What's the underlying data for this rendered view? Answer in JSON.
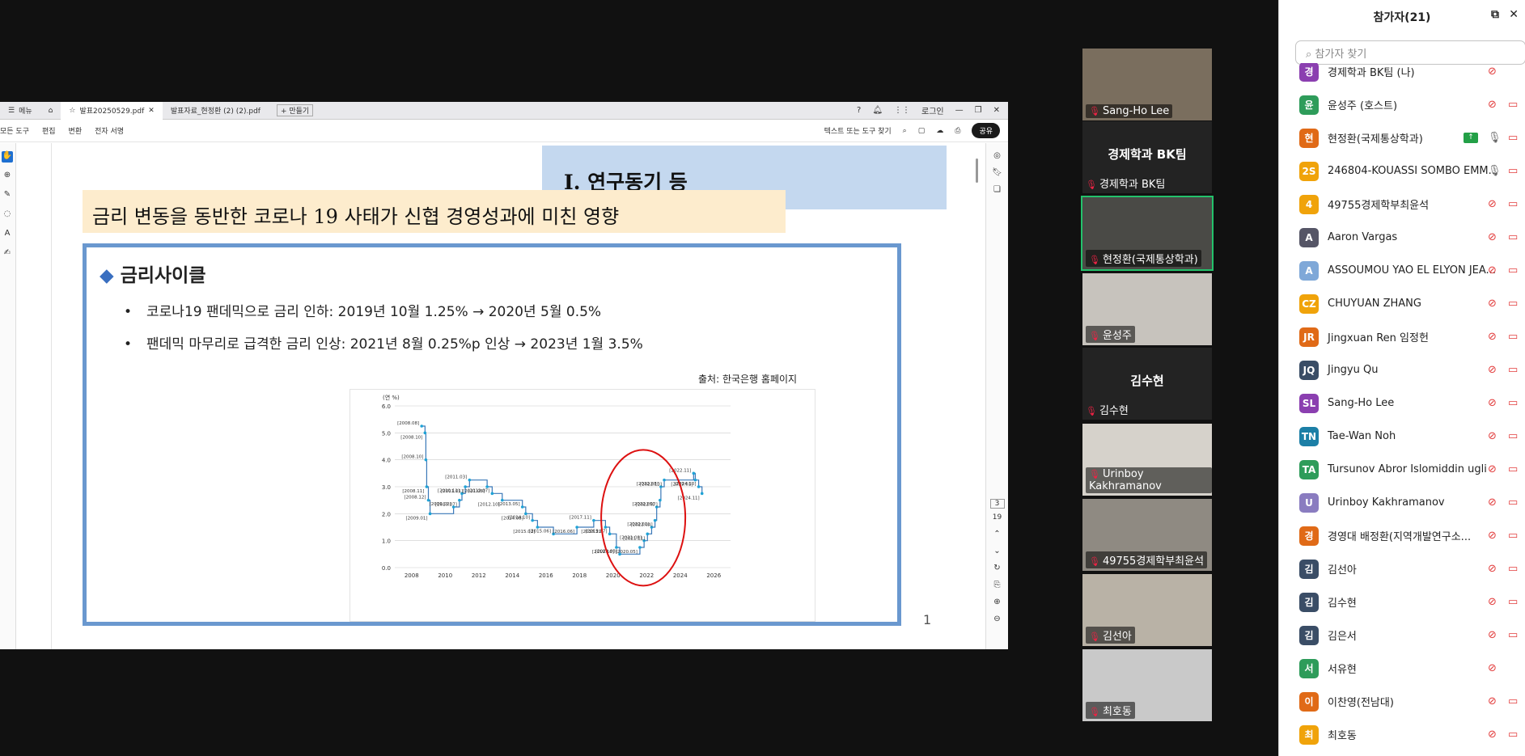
{
  "viewer": {
    "menu_label": "메뉴",
    "tab1": "발표20250529.pdf",
    "tab2": "발표자료_현정환 (2) (2).pdf",
    "new_tab": "+ 만들기",
    "login": "로그인",
    "menus": [
      "모든 도구",
      "편집",
      "변환",
      "전자 서명"
    ],
    "search": "텍스트 또는 도구 찾기",
    "share": "공유",
    "page_current": "3",
    "page_total": "19"
  },
  "slide": {
    "section": "Ⅰ. 연구동기 등",
    "banner": "금리 변동을 동반한 코로나 19 사태가 신협 경영성과에 미친 영향",
    "heading_icon": "◆",
    "heading": "금리사이클",
    "bullets": [
      "코로나19 팬데믹으로 금리 인하: 2019년 10월 1.25% → 2020년 5월 0.5%",
      "팬데믹 마무리로 급격한 금리 인상: 2021년 8월 0.25%p 인상 → 2023년 1월 3.5%"
    ],
    "source": "출처: 한국은행 홈페이지",
    "page_number": "1"
  },
  "chart_data": {
    "type": "line",
    "ylabel": "(연 %)",
    "ylim": [
      0,
      6
    ],
    "xlim": [
      2007,
      2027
    ],
    "yticks": [
      "0.0",
      "1.0",
      "2.0",
      "3.0",
      "4.0",
      "5.0",
      "6.0"
    ],
    "xticks": [
      "2008",
      "2010",
      "2012",
      "2014",
      "2016",
      "2018",
      "2020",
      "2022",
      "2024",
      "2026"
    ],
    "grid": true,
    "series": [
      {
        "x": [
          2008.6,
          2008.8,
          2008.85,
          2008.9,
          2009.0,
          2009.1,
          2010.5,
          2010.85,
          2011.0,
          2011.2,
          2011.45,
          2012.5,
          2012.8,
          2013.4,
          2014.6,
          2014.8,
          2015.2,
          2015.5,
          2016.45,
          2017.85,
          2018.85,
          2019.55,
          2019.8,
          2020.2,
          2020.4,
          2021.6,
          2021.85,
          2022.05,
          2022.3,
          2022.5,
          2022.6,
          2022.8,
          2022.85,
          2023.05,
          2024.8,
          2024.9,
          2025.1,
          2025.3
        ],
        "y": [
          5.25,
          5.0,
          4.0,
          3.0,
          2.5,
          2.0,
          2.25,
          2.5,
          2.75,
          3.0,
          3.25,
          3.0,
          2.75,
          2.5,
          2.25,
          2.0,
          1.75,
          1.5,
          1.25,
          1.5,
          1.75,
          1.5,
          1.25,
          0.75,
          0.5,
          0.75,
          1.0,
          1.25,
          1.5,
          1.75,
          2.25,
          2.5,
          3.0,
          3.25,
          3.5,
          3.25,
          3.0,
          2.75
        ]
      }
    ],
    "labels": [
      "[2008.08]",
      "[2008.10]",
      "[2008.10]",
      "[2008.11]",
      "[2008.12]",
      "[2009.01]",
      "[2009.02]",
      "[2010.07]",
      "[2010.11]",
      "[2011.01]",
      "[2011.03]",
      "[2011.06]",
      "[2012.07]",
      "[2012.10]",
      "[2013.05]",
      "[2014.08]",
      "[2014.10]",
      "[2015.03]",
      "[2015.06]",
      "[2016.06]",
      "[2017.11]",
      "[2018.11]",
      "[2019.07]",
      "[2019.10]",
      "[2020.03]",
      "[2020.05]",
      "[2021.08]",
      "[2021.11]",
      "[2022.01]",
      "[2022.04]",
      "[2022.05]",
      "[2022.07]",
      "[2022.08]",
      "[2022.10]",
      "[2022.11]",
      "[2023.01]",
      "[2024.10]",
      "[2024.11]",
      "[2025.02]"
    ]
  },
  "gallery": [
    {
      "type": "video",
      "name": "Sang-Ho Lee",
      "bg": "#7a6e5e"
    },
    {
      "type": "card",
      "big": "경제학과 BK팀",
      "name": "경제학과 BK팀"
    },
    {
      "type": "video",
      "name": "현정환(국제통상학과)",
      "bg": "#4a4a46",
      "active": true
    },
    {
      "type": "video",
      "name": "윤성주",
      "bg": "#c7c3bd"
    },
    {
      "type": "card",
      "big": "김수현",
      "name": "김수현"
    },
    {
      "type": "video",
      "name": "Urinboy Kakhramanov",
      "bg": "#d6d2cb"
    },
    {
      "type": "video",
      "name": "49755경제학부최윤석",
      "bg": "#8f8a82"
    },
    {
      "type": "video",
      "name": "김선아",
      "bg": "#b9b2a6"
    },
    {
      "type": "video",
      "name": "최호동",
      "bg": "#c9c9c9"
    }
  ],
  "participants": {
    "title": "참가자(21)",
    "search_placeholder": "참가자 찾기",
    "list": [
      {
        "initial": "경",
        "color": "#8b3fb0",
        "name": "경제학과 BK팀 (나)",
        "mic": "muted",
        "cam": "none"
      },
      {
        "initial": "윤",
        "color": "#2e9c5a",
        "name": "윤성주 (호스트)",
        "mic": "muted",
        "cam": "off"
      },
      {
        "initial": "현",
        "color": "#e06a17",
        "name": "현정환(국제통상학과)",
        "mic": "on",
        "cam": "off",
        "sharing": true
      },
      {
        "initial": "2S",
        "color": "#f0a30a",
        "name": "246804-KOUASSI SOMBO EMM...",
        "mic": "on",
        "cam": "off"
      },
      {
        "initial": "4",
        "color": "#f0a30a",
        "name": "49755경제학부최윤석",
        "mic": "muted",
        "cam": "off"
      },
      {
        "initial": "A",
        "color": "#556",
        "name": "Aaron Vargas",
        "mic": "muted",
        "cam": "off"
      },
      {
        "initial": "A",
        "color": "#7fa8d8",
        "name": "ASSOUMOU YAO EL ELYON JEA...",
        "mic": "muted",
        "cam": "off"
      },
      {
        "initial": "CZ",
        "color": "#f0a30a",
        "name": "CHUYUAN ZHANG",
        "mic": "muted",
        "cam": "off"
      },
      {
        "initial": "JR",
        "color": "#e06a17",
        "name": "Jingxuan Ren  임정헌",
        "mic": "muted",
        "cam": "off"
      },
      {
        "initial": "JQ",
        "color": "#3a4d66",
        "name": "Jingyu Qu",
        "mic": "muted",
        "cam": "off"
      },
      {
        "initial": "SL",
        "color": "#8b3fb0",
        "name": "Sang-Ho Lee",
        "mic": "muted",
        "cam": "off"
      },
      {
        "initial": "TN",
        "color": "#1c7fa6",
        "name": "Tae-Wan Noh",
        "mic": "muted",
        "cam": "off"
      },
      {
        "initial": "TA",
        "color": "#2e9c5a",
        "name": "Tursunov Abror Islomiddin ugli",
        "mic": "muted",
        "cam": "off"
      },
      {
        "initial": "U",
        "color": "#8a7cc0",
        "name": "Urinboy Kakhramanov",
        "mic": "muted",
        "cam": "off"
      },
      {
        "initial": "경",
        "color": "#e06a17",
        "name": "경영대 배정환(지역개발연구소...",
        "mic": "muted",
        "cam": "off"
      },
      {
        "initial": "김",
        "color": "#3a4d66",
        "name": "김선아",
        "mic": "muted",
        "cam": "off"
      },
      {
        "initial": "김",
        "color": "#3a4d66",
        "name": "김수현",
        "mic": "muted",
        "cam": "off"
      },
      {
        "initial": "김",
        "color": "#3a4d66",
        "name": "김은서",
        "mic": "muted",
        "cam": "off"
      },
      {
        "initial": "서",
        "color": "#2e9c5a",
        "name": "서유현",
        "mic": "muted",
        "cam": "none"
      },
      {
        "initial": "이",
        "color": "#e06a17",
        "name": "이찬영(전남대)",
        "mic": "muted",
        "cam": "off"
      },
      {
        "initial": "최",
        "color": "#f0a30a",
        "name": "최호동",
        "mic": "muted",
        "cam": "off"
      }
    ]
  }
}
